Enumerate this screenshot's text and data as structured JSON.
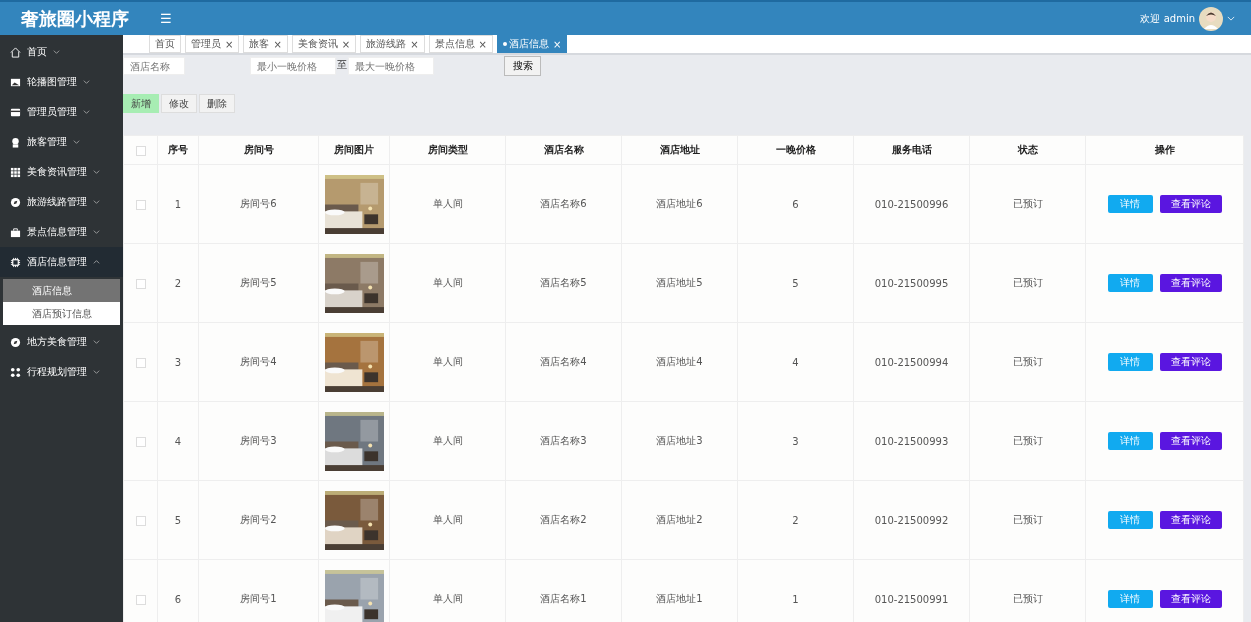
{
  "header": {
    "title": "奢旅圈小程序",
    "menu_icon": "☰",
    "greeting": "欢迎 admin"
  },
  "sidebar": {
    "items": [
      {
        "label": "首页",
        "kind": "home",
        "expanded": false
      },
      {
        "label": "轮播图管理",
        "expanded": false
      },
      {
        "label": "管理员管理",
        "kind": "card",
        "expanded": false
      },
      {
        "label": "旅客管理",
        "kind": "person",
        "expanded": false
      },
      {
        "label": "美食资讯管理",
        "kind": "grid",
        "expanded": false
      },
      {
        "label": "旅游线路管理",
        "kind": "compass",
        "expanded": false
      },
      {
        "label": "景点信息管理",
        "kind": "bag",
        "expanded": false
      },
      {
        "label": "酒店信息管理",
        "kind": "chip",
        "expanded": true,
        "children": [
          {
            "label": "酒店信息",
            "selected": true
          },
          {
            "label": "酒店预订信息",
            "selected": false
          }
        ]
      },
      {
        "label": "地方美食管理",
        "kind": "compass",
        "expanded": false
      },
      {
        "label": "行程规划管理",
        "kind": "apps",
        "expanded": false
      }
    ]
  },
  "tabs": [
    {
      "label": "首页",
      "selected": false
    },
    {
      "label": "管理员",
      "close": "×",
      "selected": false
    },
    {
      "label": "旅客",
      "close": "×",
      "selected": false
    },
    {
      "label": "美食资讯",
      "close": "×",
      "selected": false
    },
    {
      "label": "旅游线路",
      "close": "×",
      "selected": false
    },
    {
      "label": "景点信息",
      "close": "×",
      "selected": false
    },
    {
      "label": "酒店信息",
      "close": "×",
      "selected": true
    }
  ],
  "search": {
    "name_placeholder": "酒店名称",
    "min_placeholder": "最小一晚价格",
    "separator": "至",
    "max_placeholder": "最大一晚价格",
    "button": "搜索"
  },
  "actions": [
    {
      "label": "新增",
      "kind": "add"
    },
    {
      "label": "修改",
      "kind": "plain"
    },
    {
      "label": "删除",
      "kind": "plain"
    }
  ],
  "table": {
    "select_all_checked": false,
    "columns": [
      "序号",
      "房间号",
      "房间图片",
      "房间类型",
      "酒店名称",
      "酒店地址",
      "一晚价格",
      "服务电话",
      "状态",
      "操作"
    ],
    "rows": [
      {
        "checked": false,
        "index": "1",
        "room": "房间号6",
        "type": "单人间",
        "hotel": "酒店名称6",
        "address": "酒店地址6",
        "price": "6",
        "phone": "010-21500996",
        "status": "已预订",
        "buttons": [
          "详情",
          "查看评论"
        ]
      },
      {
        "checked": false,
        "index": "2",
        "room": "房间号5",
        "type": "单人间",
        "hotel": "酒店名称5",
        "address": "酒店地址5",
        "price": "5",
        "phone": "010-21500995",
        "status": "已预订",
        "buttons": [
          "详情",
          "查看评论"
        ]
      },
      {
        "checked": false,
        "index": "3",
        "room": "房间号4",
        "type": "单人间",
        "hotel": "酒店名称4",
        "address": "酒店地址4",
        "price": "4",
        "phone": "010-21500994",
        "status": "已预订",
        "buttons": [
          "详情",
          "查看评论"
        ]
      },
      {
        "checked": false,
        "index": "4",
        "room": "房间号3",
        "type": "单人间",
        "hotel": "酒店名称3",
        "address": "酒店地址3",
        "price": "3",
        "phone": "010-21500993",
        "status": "已预订",
        "buttons": [
          "详情",
          "查看评论"
        ]
      },
      {
        "checked": false,
        "index": "5",
        "room": "房间号2",
        "type": "单人间",
        "hotel": "酒店名称2",
        "address": "酒店地址2",
        "price": "2",
        "phone": "010-21500992",
        "status": "已预订",
        "buttons": [
          "详情",
          "查看评论"
        ]
      },
      {
        "checked": false,
        "index": "6",
        "room": "房间号1",
        "type": "单人间",
        "hotel": "酒店名称1",
        "address": "酒店地址1",
        "price": "1",
        "phone": "010-21500991",
        "status": "已预订",
        "buttons": [
          "详情",
          "查看评论"
        ]
      }
    ]
  }
}
